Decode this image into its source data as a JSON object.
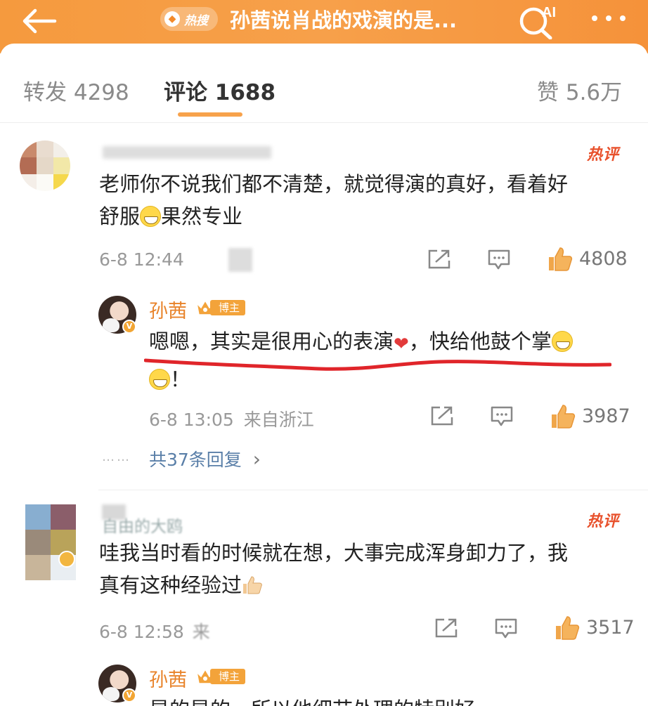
{
  "header": {
    "hot_label": "热搜",
    "title": "孙茜说肖战的戏演的是...",
    "ai_label": "AI"
  },
  "tabs": [
    {
      "label": "转发 4298"
    },
    {
      "label": "评论 1688"
    },
    {
      "label": "赞 5.6万"
    }
  ],
  "comments": [
    {
      "hot_tag": "热评",
      "text_line1": "老师你不说我们都不清楚，就觉得演的真好，看着好",
      "text_line2_before": "舒服",
      "text_line2_after": "果然专业",
      "time": "6-8 12:44",
      "likes": "4808",
      "reply": {
        "name": "孙茜",
        "badge": "博主",
        "text_part1": "嗯嗯，其实是很用心的表演",
        "text_part2": "，快给他鼓个掌",
        "text_line2": "！",
        "time": "6-8 13:05",
        "location": "来自浙江",
        "likes": "3987"
      },
      "more_replies": "共37条回复",
      "more_chevron": "›",
      "dots": "……"
    },
    {
      "hot_tag": "热评",
      "username_partial": "自由的大鸥",
      "text_line1": "哇我当时看的时候就在想，大事完成浑身卸力了，我",
      "text_line2": "真有这种经验过",
      "time": "6-8 12:58",
      "time_suffix": "来",
      "likes": "3517",
      "reply": {
        "name": "孙茜",
        "badge": "博主",
        "text_partial": "是的是的，所以他细节处理的特别好"
      }
    }
  ]
}
